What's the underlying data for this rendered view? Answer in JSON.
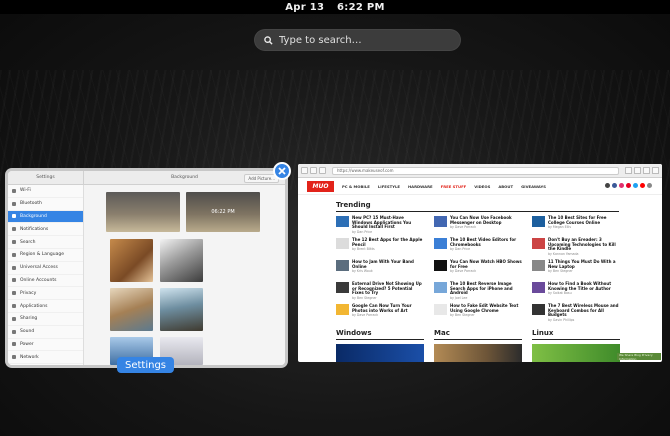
{
  "topbar": {
    "date": "Apr 13",
    "time": "6:22 PM"
  },
  "search": {
    "placeholder": "Type to search…"
  },
  "settings_window": {
    "label": "Settings",
    "header_left": "Settings",
    "header_title": "Background",
    "header_button": "Add Picture...",
    "lock_time": "06:22 PM",
    "sidebar": [
      "Wi-Fi",
      "Bluetooth",
      "Background",
      "Notifications",
      "Search",
      "Region & Language",
      "Universal Access",
      "Online Accounts",
      "Privacy",
      "Applications",
      "Sharing",
      "Sound",
      "Power",
      "Network"
    ],
    "active_index": 2
  },
  "browser_window": {
    "url": "https://www.makeuseof.com",
    "logo": "MUO",
    "nav": [
      "PC & MOBILE",
      "LIFESTYLE",
      "HARDWARE",
      "FREE STUFF",
      "VIDEOS",
      "ABOUT",
      "GIVEAWAYS"
    ],
    "trending_title": "Trending",
    "sections": [
      "Windows",
      "Mac",
      "Linux"
    ],
    "colors": {
      "brand": "#e2231a",
      "accent": "#3584e4"
    },
    "columns": [
      [
        {
          "title": "New PC? 15 Must-Have Windows Applications You Should Install First",
          "by": "by Dan Price"
        },
        {
          "title": "The 12 Best Apps for the Apple Pencil",
          "by": "by Brent Blitts"
        },
        {
          "title": "How to Jam With Your Band Online",
          "by": "by Kris Wouk"
        },
        {
          "title": "External Drive Not Showing Up or Recognized? 5 Potential Fixes to Try",
          "by": "by Ben Stegner"
        },
        {
          "title": "Google Can Now Turn Your Photos into Works of Art",
          "by": "by Dave Parrack"
        }
      ],
      [
        {
          "title": "You Can Now Use Facebook Messenger on Desktop",
          "by": "by Dave Parrack"
        },
        {
          "title": "The 10 Best Video Editors for Chromebooks",
          "by": "by Dan Price"
        },
        {
          "title": "You Can Now Watch HBO Shows for Free",
          "by": "by Dave Parrack"
        },
        {
          "title": "The 10 Best Reverse Image Search Apps for iPhone and Android",
          "by": "by Joel Lee"
        },
        {
          "title": "How to Fake Edit Website Text Using Google Chrome",
          "by": "by Ben Stegner"
        }
      ],
      [
        {
          "title": "The 10 Best Sites for Free College Courses Online",
          "by": "by Megan Ellis"
        },
        {
          "title": "Don't Buy an Ereader: 3 Upcoming Technologies to Kill the Kindle",
          "by": "by Kannon Yamada"
        },
        {
          "title": "11 Things You Must Do With a New Laptop",
          "by": "by Ben Stegner"
        },
        {
          "title": "How to Find a Book Without Knowing the Title or Author",
          "by": "by Saikat Basu"
        },
        {
          "title": "The 7 Best Wireless Mouse and Keyboard Combos for All Budgets",
          "by": "by Gavin Phillips"
        }
      ]
    ],
    "share_text": "We Share Blog Privacy Information"
  }
}
